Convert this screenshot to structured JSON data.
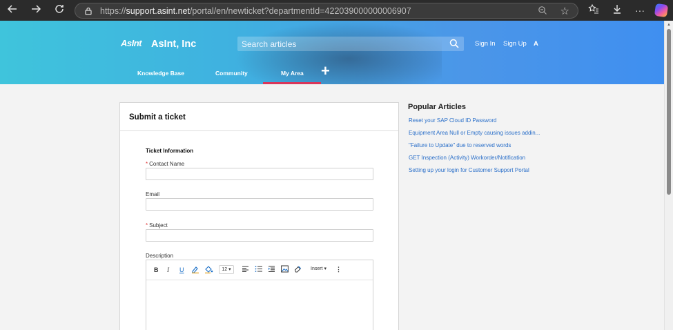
{
  "browser": {
    "url_prefix": "https://",
    "url_domain": "support.asint.net",
    "url_path": "/portal/en/newticket?departmentId=422039000000006907",
    "icons": [
      "back-icon",
      "forward-icon",
      "refresh-icon",
      "lock-icon",
      "zoom-out-icon",
      "favorite-star-icon",
      "favorites-list-icon",
      "download-icon",
      "more-icon",
      "copilot-icon"
    ]
  },
  "header": {
    "logo_text": "AsInt",
    "brand_name": "AsInt, Inc",
    "search_placeholder": "Search articles",
    "sign_in": "Sign In",
    "sign_up": "Sign Up",
    "a11y_label": "A",
    "tabs": [
      {
        "label": "Knowledge Base"
      },
      {
        "label": "Community"
      },
      {
        "label": "My Area",
        "active": true
      }
    ],
    "plus_label": "+",
    "colors": {
      "gradient_start": "#3fc4dc",
      "gradient_end": "#3f8ff0",
      "active_tab": "#d9365a"
    }
  },
  "form": {
    "title": "Submit a ticket",
    "section_title": "Ticket Information",
    "required_mark": "*",
    "fields": [
      {
        "label": "Contact Name",
        "required": true,
        "value": ""
      },
      {
        "label": "Email",
        "required": false,
        "value": ""
      },
      {
        "label": "Subject",
        "required": true,
        "value": ""
      }
    ],
    "description_label": "Description",
    "editor": {
      "bold": "B",
      "italic": "I",
      "underline": "U",
      "font_size": "12",
      "insert_label": "Insert",
      "more": "⋮"
    }
  },
  "sidebar": {
    "title": "Popular Articles",
    "articles": [
      "Reset your SAP Cloud ID Password",
      "Equipment Area Null or Empty causing issues addin...",
      "\"Failure to Update\" due to reserved words",
      "GET Inspection (Activity) Workorder/Notification",
      "Setting up your login for Customer Support Portal"
    ],
    "link_color": "#2a6fc9"
  }
}
